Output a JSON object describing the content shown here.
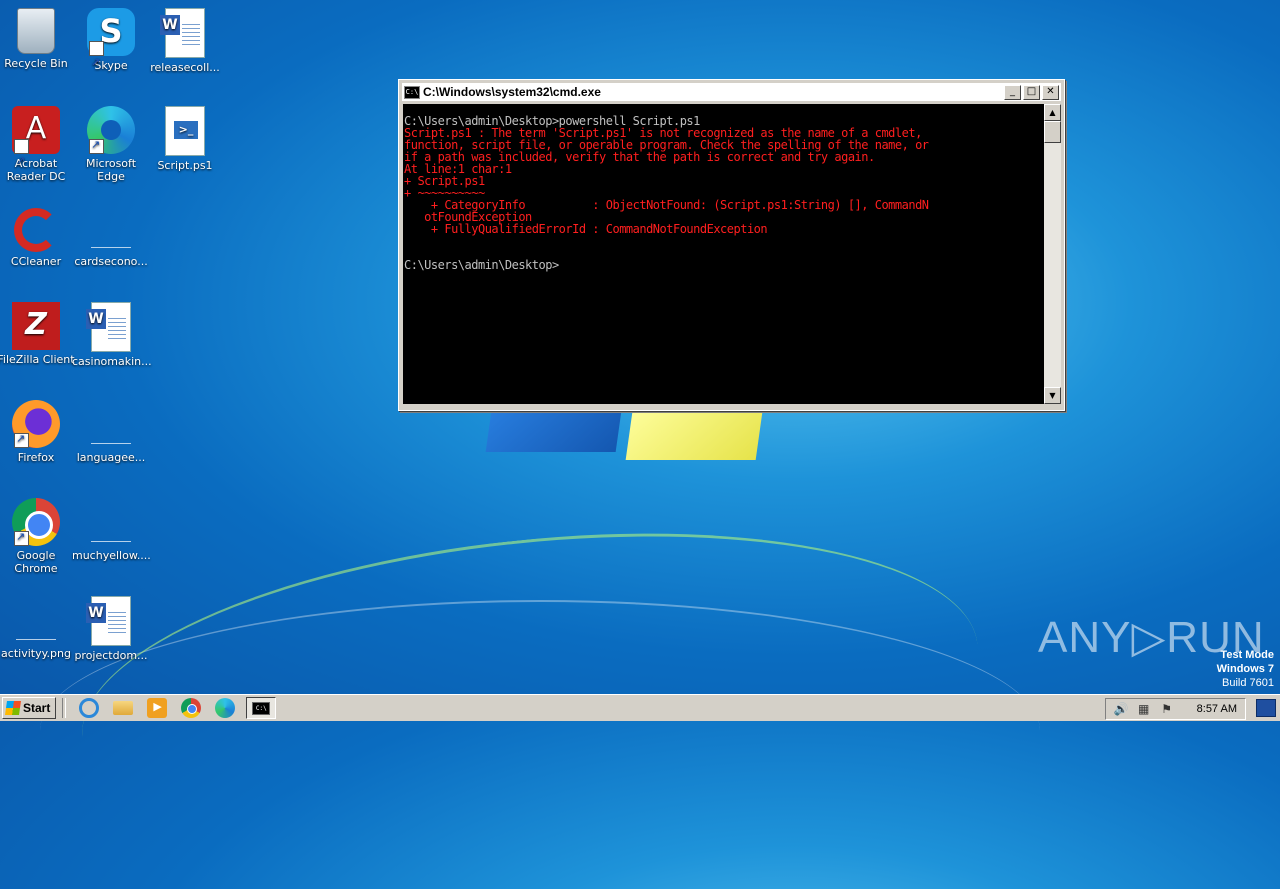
{
  "desktop": {
    "icons": [
      {
        "label": "Recycle Bin",
        "icon": "recycle-bin-icon"
      },
      {
        "label": "Skype",
        "icon": "skype-icon",
        "glyph": "S"
      },
      {
        "label": "releasecoll...",
        "icon": "word-document-icon"
      },
      {
        "label": "Acrobat Reader DC",
        "icon": "acrobat-icon",
        "glyph": "A"
      },
      {
        "label": "Microsoft Edge",
        "icon": "edge-icon"
      },
      {
        "label": "Script.ps1",
        "icon": "powershell-script-icon",
        "glyph": ">_"
      },
      {
        "label": "CCleaner",
        "icon": "ccleaner-icon"
      },
      {
        "label": "cardsecono...",
        "icon": "blank-file-icon"
      },
      {
        "label": "FileZilla Client",
        "icon": "filezilla-icon",
        "glyph": "Z"
      },
      {
        "label": "casinomakin...",
        "icon": "word-document-icon"
      },
      {
        "label": "Firefox",
        "icon": "firefox-icon"
      },
      {
        "label": "languagee...",
        "icon": "blank-file-icon"
      },
      {
        "label": "Google Chrome",
        "icon": "chrome-icon"
      },
      {
        "label": "muchyellow....",
        "icon": "blank-file-icon"
      },
      {
        "label": "activityy.png",
        "icon": "blank-file-icon"
      },
      {
        "label": "projectdom...",
        "icon": "word-document-icon"
      }
    ],
    "word_glyph": "W"
  },
  "cmd_window": {
    "title": "C:\\Windows\\system32\\cmd.exe",
    "icon_glyph": "C:\\",
    "buttons": {
      "minimize": "_",
      "maximize": "□",
      "close": "✕"
    },
    "lines": [
      {
        "text": "C:\\Users\\admin\\Desktop>powershell Script.ps1",
        "color": "white"
      },
      {
        "text": "Script.ps1 : The term 'Script.ps1' is not recognized as the name of a cmdlet,",
        "color": "red"
      },
      {
        "text": "function, script file, or operable program. Check the spelling of the name, or",
        "color": "red"
      },
      {
        "text": "if a path was included, verify that the path is correct and try again.",
        "color": "red"
      },
      {
        "text": "At line:1 char:1",
        "color": "red"
      },
      {
        "text": "+ Script.ps1",
        "color": "red"
      },
      {
        "text": "+ ~~~~~~~~~~",
        "color": "red"
      },
      {
        "text": "    + CategoryInfo          : ObjectNotFound: (Script.ps1:String) [], CommandN",
        "color": "red"
      },
      {
        "text": "   otFoundException",
        "color": "red"
      },
      {
        "text": "    + FullyQualifiedErrorId : CommandNotFoundException",
        "color": "red"
      },
      {
        "text": "",
        "color": "white"
      },
      {
        "text": "",
        "color": "white"
      },
      {
        "text": "C:\\Users\\admin\\Desktop>",
        "color": "white"
      }
    ],
    "colors": {
      "white": "#c0c0c0",
      "red": "#ff1f1f",
      "background": "#000000"
    }
  },
  "watermark": {
    "text": "ANY▷RUN"
  },
  "test_mode": {
    "line1": "Test Mode",
    "line2": "Windows 7",
    "line3": "Build 7601"
  },
  "taskbar": {
    "start_label": "Start",
    "quick_launch": [
      "internet-explorer-icon",
      "folder-icon",
      "media-player-icon",
      "chrome-icon",
      "edge-icon"
    ],
    "active_task_glyph": "C:\\",
    "tray_glyphs": {
      "volume": "🔊",
      "network": "▦",
      "flag": "⚑"
    },
    "clock": "8:57 AM"
  }
}
